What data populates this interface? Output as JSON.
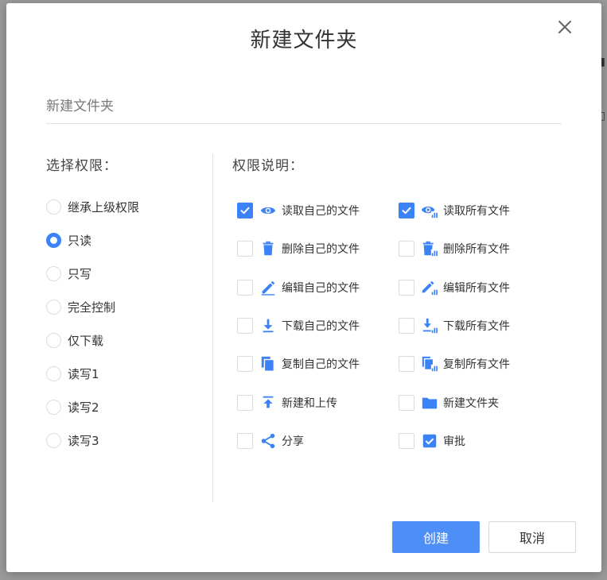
{
  "dialog": {
    "title": "新建文件夹",
    "close_icon": "close-icon"
  },
  "name_input": {
    "value": "",
    "placeholder": "新建文件夹"
  },
  "permissions_select": {
    "label": "选择权限：",
    "options": [
      {
        "label": "继承上级权限",
        "checked": false
      },
      {
        "label": "只读",
        "checked": true
      },
      {
        "label": "只写",
        "checked": false
      },
      {
        "label": "完全控制",
        "checked": false
      },
      {
        "label": "仅下载",
        "checked": false
      },
      {
        "label": "读写1",
        "checked": false
      },
      {
        "label": "读写2",
        "checked": false
      },
      {
        "label": "读写3",
        "checked": false
      }
    ]
  },
  "permissions_desc": {
    "label": "权限说明：",
    "items": [
      {
        "label": "读取自己的文件",
        "icon": "eye-icon",
        "checked": true
      },
      {
        "label": "读取所有文件",
        "icon": "eye-all-icon",
        "checked": true
      },
      {
        "label": "删除自己的文件",
        "icon": "trash-icon",
        "checked": false
      },
      {
        "label": "删除所有文件",
        "icon": "trash-all-icon",
        "checked": false
      },
      {
        "label": "编辑自己的文件",
        "icon": "pencil-icon",
        "checked": false
      },
      {
        "label": "编辑所有文件",
        "icon": "pencil-all-icon",
        "checked": false
      },
      {
        "label": "下载自己的文件",
        "icon": "download-icon",
        "checked": false
      },
      {
        "label": "下载所有文件",
        "icon": "download-all-icon",
        "checked": false
      },
      {
        "label": "复制自己的文件",
        "icon": "copy-icon",
        "checked": false
      },
      {
        "label": "复制所有文件",
        "icon": "copy-all-icon",
        "checked": false
      },
      {
        "label": "新建和上传",
        "icon": "upload-icon",
        "checked": false
      },
      {
        "label": "新建文件夹",
        "icon": "folder-icon",
        "checked": false
      },
      {
        "label": "分享",
        "icon": "share-icon",
        "checked": false
      },
      {
        "label": "审批",
        "icon": "approve-icon",
        "checked": false
      }
    ]
  },
  "actions": {
    "create_label": "创建",
    "cancel_label": "取消"
  },
  "colors": {
    "accent": "#3b82f6",
    "primary_button": "#4d8ef7"
  }
}
